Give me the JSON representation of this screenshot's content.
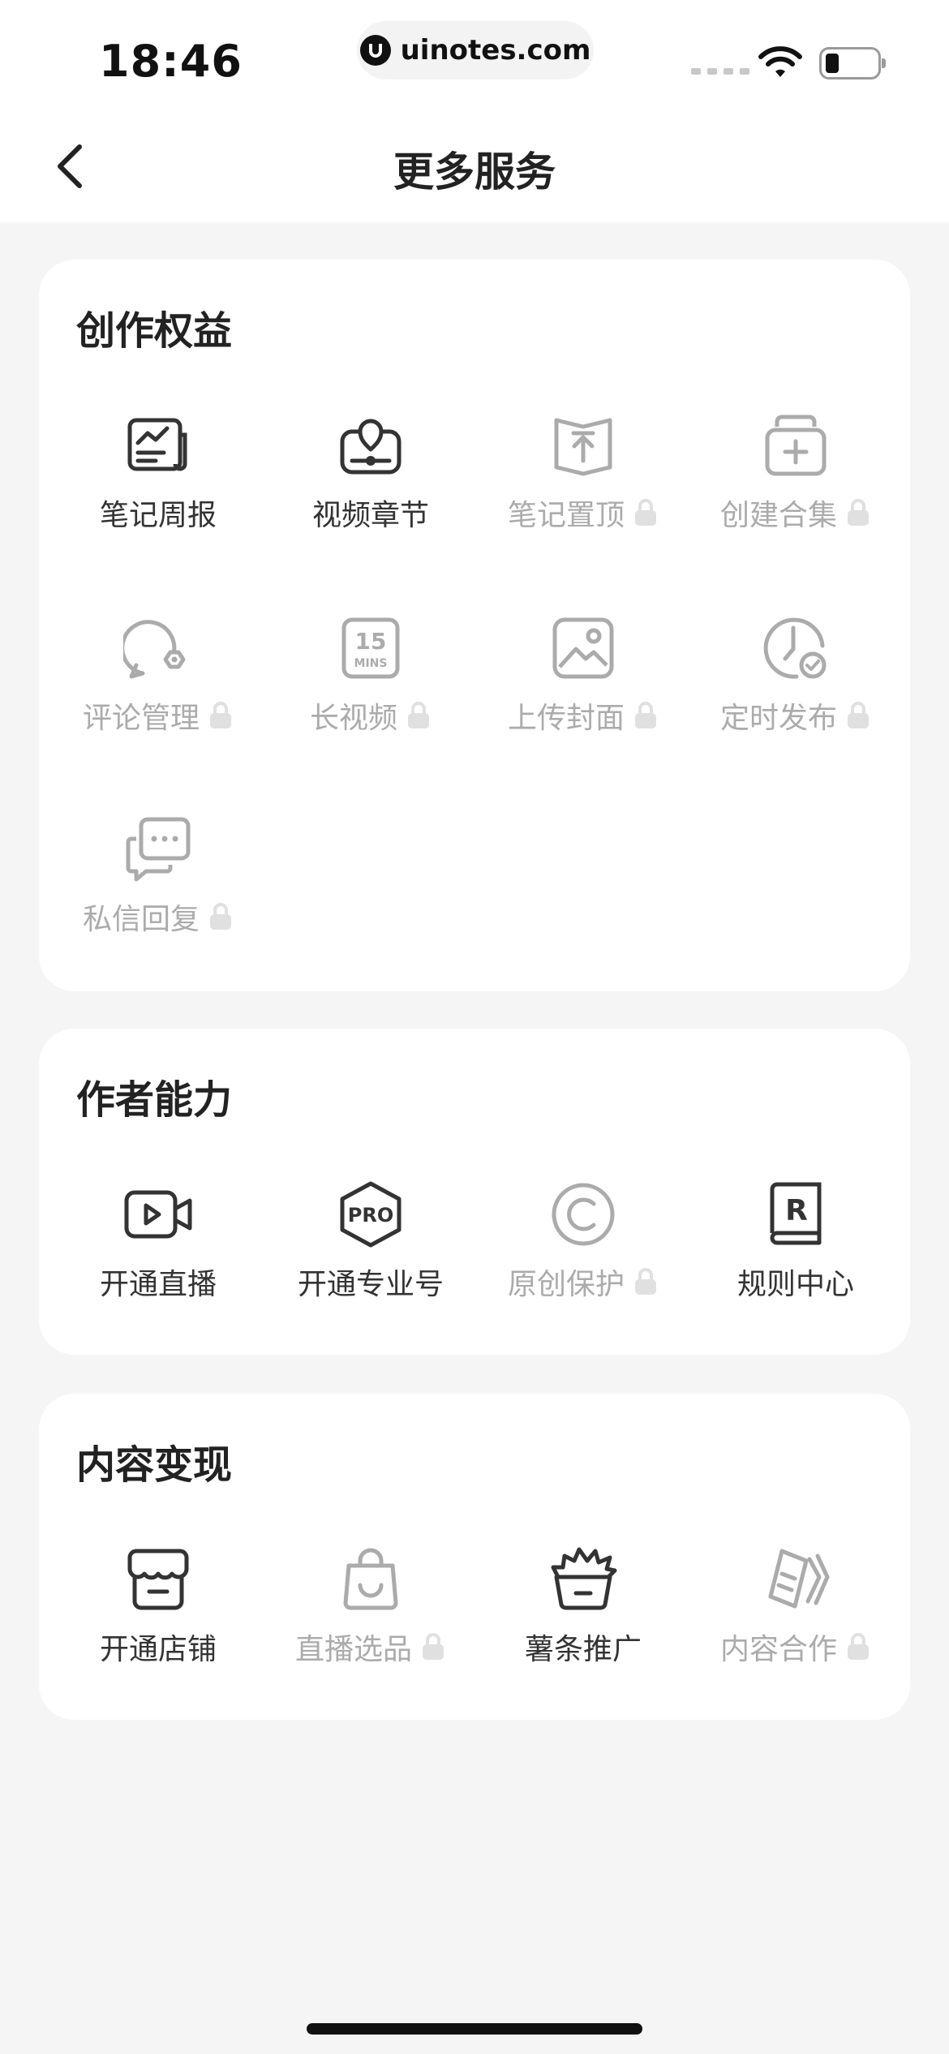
{
  "status_bar": {
    "time": "18:46",
    "url": "uinotes.com"
  },
  "header": {
    "title": "更多服务"
  },
  "sections": [
    {
      "title": "创作权益",
      "items": [
        {
          "label": "笔记周报",
          "icon": "weekly-report-icon",
          "locked": false
        },
        {
          "label": "视频章节",
          "icon": "video-chapter-icon",
          "locked": false
        },
        {
          "label": "笔记置顶",
          "icon": "pin-top-icon",
          "locked": true
        },
        {
          "label": "创建合集",
          "icon": "create-collection-icon",
          "locked": true
        },
        {
          "label": "评论管理",
          "icon": "comment-manage-icon",
          "locked": true
        },
        {
          "label": "长视频",
          "icon": "long-video-icon",
          "locked": true
        },
        {
          "label": "上传封面",
          "icon": "upload-cover-icon",
          "locked": true
        },
        {
          "label": "定时发布",
          "icon": "scheduled-publish-icon",
          "locked": true
        },
        {
          "label": "私信回复",
          "icon": "message-reply-icon",
          "locked": true
        }
      ]
    },
    {
      "title": "作者能力",
      "items": [
        {
          "label": "开通直播",
          "icon": "live-video-icon",
          "locked": false
        },
        {
          "label": "开通专业号",
          "icon": "pro-badge-icon",
          "locked": false
        },
        {
          "label": "原创保护",
          "icon": "copyright-icon",
          "locked": true
        },
        {
          "label": "规则中心",
          "icon": "rule-book-icon",
          "locked": false
        }
      ]
    },
    {
      "title": "内容变现",
      "items": [
        {
          "label": "开通店铺",
          "icon": "store-icon",
          "locked": false
        },
        {
          "label": "直播选品",
          "icon": "shopping-bag-icon",
          "locked": true
        },
        {
          "label": "薯条推广",
          "icon": "fries-promo-icon",
          "locked": false
        },
        {
          "label": "内容合作",
          "icon": "content-coop-icon",
          "locked": true
        }
      ]
    }
  ],
  "icon_text": {
    "long_video_number": "15",
    "long_video_unit": "MINS",
    "pro": "PRO",
    "rule": "R"
  },
  "colors": {
    "enabled": "#333333",
    "disabled": "#ababab",
    "background": "#f5f5f5"
  }
}
